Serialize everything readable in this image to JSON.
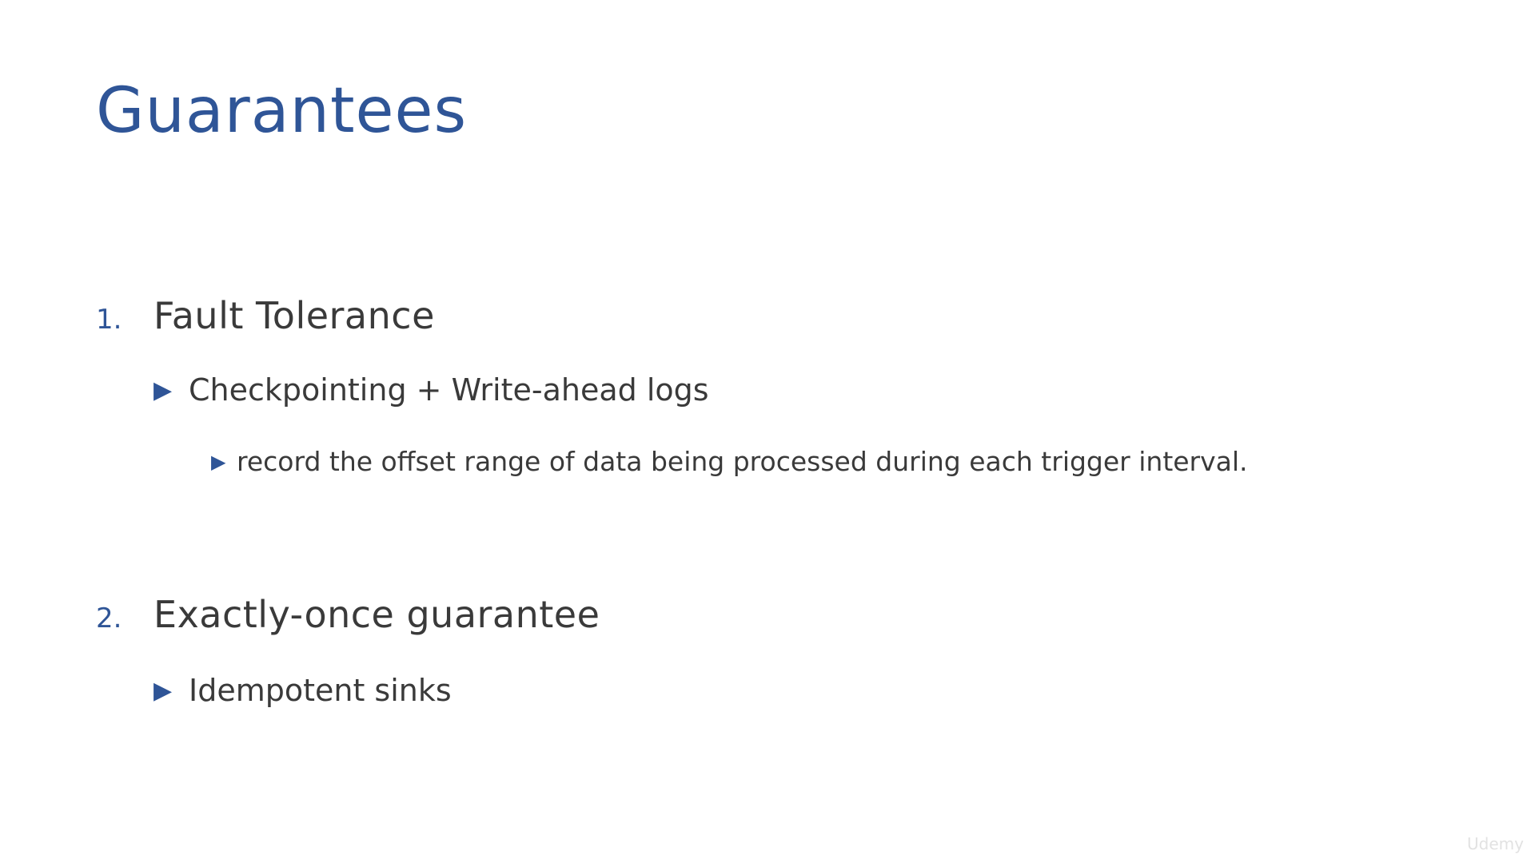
{
  "slide": {
    "title": "Guarantees",
    "sections": [
      {
        "number": "1.",
        "heading": "Fault Tolerance",
        "bullets": [
          {
            "text": "Checkpointing + Write-ahead logs",
            "sub": [
              "record the offset range of data being processed during each trigger interval."
            ]
          }
        ]
      },
      {
        "number": "2.",
        "heading": "Exactly-once guarantee",
        "bullets": [
          {
            "text": "Idempotent sinks"
          }
        ]
      }
    ],
    "bullet_icon": "triangle-right-icon",
    "watermark": "Udemy"
  },
  "colors": {
    "accent": "#2f5597",
    "text": "#3a3a3a",
    "background": "#ffffff"
  }
}
